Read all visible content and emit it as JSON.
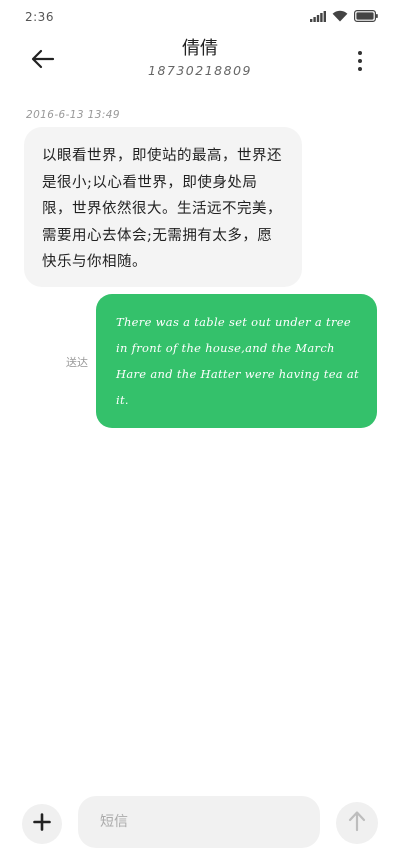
{
  "status_bar": {
    "time": "2:36",
    "icons": [
      "signal-icon",
      "wifi-icon",
      "battery-icon"
    ]
  },
  "header": {
    "contact_name": "倩倩",
    "contact_number": "18730218809",
    "back_icon": "back-arrow-icon",
    "more_icon": "more-vertical-icon"
  },
  "conversation": {
    "timestamp": "2016-6-13 13:49",
    "received_message": "以眼看世界，即使站的最高，世界还是很小;以心看世界，即使身处局限，世界依然很大。生活远不完美，需要用心去体会;无需拥有太多，愿快乐与你相随。",
    "sent_message": "There was a table set out under a tree in front of the house,and the March Hare and the Hatter were having tea at it.",
    "sent_status": "送达"
  },
  "composer": {
    "placeholder": "短信",
    "value": "",
    "add_icon": "plus-icon",
    "send_icon": "send-arrow-icon"
  },
  "colors": {
    "sent_bubble": "#34c16b",
    "received_bubble": "#f4f4f4",
    "background": "#ffffff"
  }
}
